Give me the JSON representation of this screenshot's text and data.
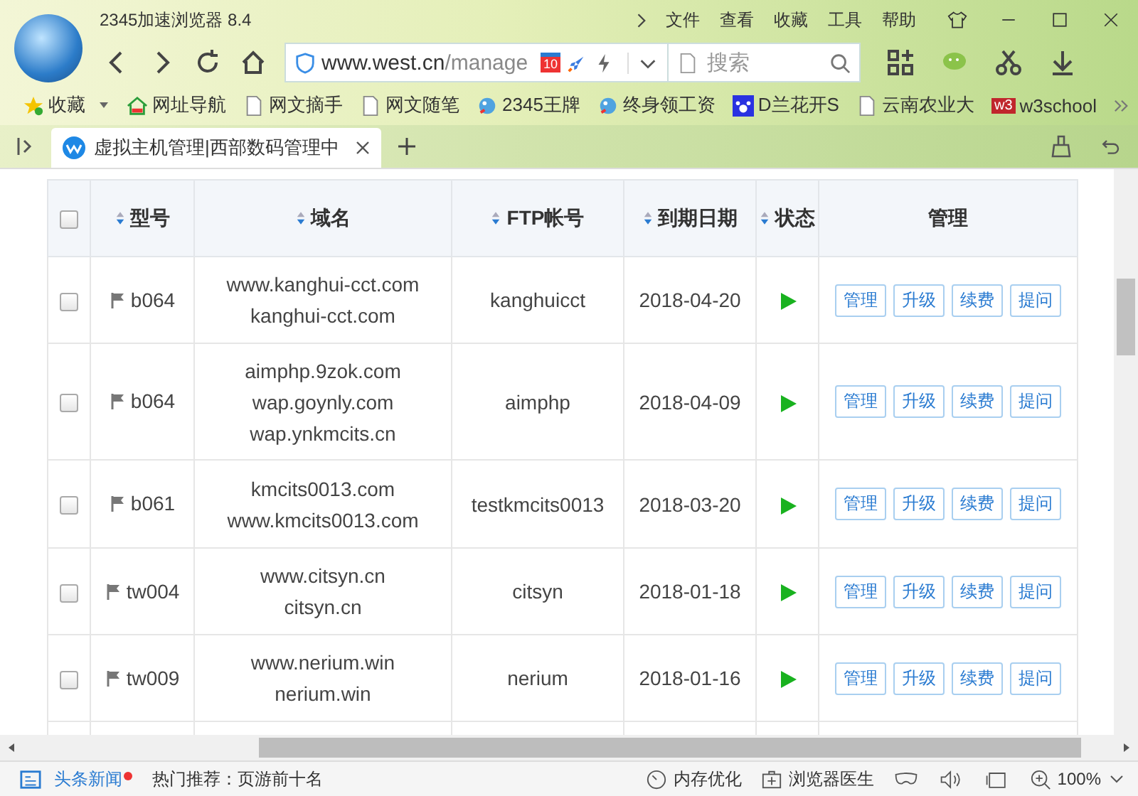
{
  "window": {
    "title": "2345加速浏览器 8.4"
  },
  "menu": [
    "文件",
    "查看",
    "收藏",
    "工具",
    "帮助"
  ],
  "address": {
    "url_host": "www.west.cn",
    "url_path": "/manage",
    "badge": "10"
  },
  "search": {
    "placeholder": "搜索"
  },
  "bookmarks": [
    {
      "label": "收藏",
      "kind": "star"
    },
    {
      "label": "网址导航",
      "kind": "home"
    },
    {
      "label": "网文摘手",
      "kind": "page"
    },
    {
      "label": "网文随笔",
      "kind": "page"
    },
    {
      "label": "2345王牌",
      "kind": "bird"
    },
    {
      "label": "终身领工资",
      "kind": "bird"
    },
    {
      "label": "D兰花开S",
      "kind": "paw"
    },
    {
      "label": "云南农业大",
      "kind": "page"
    },
    {
      "label": "w3school",
      "kind": "w3",
      "badge": "w3"
    }
  ],
  "tabs": [
    {
      "title": "虚拟主机管理|西部数码管理中",
      "selected": true
    }
  ],
  "table": {
    "all_checked": false,
    "columns": [
      {
        "label": "型号",
        "sortable": true
      },
      {
        "label": "域名",
        "sortable": true
      },
      {
        "label": "FTP帐号",
        "sortable": true
      },
      {
        "label": "到期日期",
        "sortable": true
      },
      {
        "label": "状态",
        "sortable": true
      },
      {
        "label": "管理",
        "sortable": false
      }
    ],
    "rows": [
      {
        "checked": false,
        "model": "b064",
        "domains": [
          "www.kanghui-cct.com",
          "kanghui-cct.com"
        ],
        "ftp": "kanghuicct",
        "expiry": "2018-04-20",
        "running": true,
        "actions": [
          "管理",
          "升级",
          "续费",
          "提问"
        ]
      },
      {
        "checked": false,
        "model": "b064",
        "domains": [
          "aimphp.9zok.com",
          "wap.goynly.com",
          "wap.ynkmcits.cn"
        ],
        "ftp": "aimphp",
        "expiry": "2018-04-09",
        "running": true,
        "actions": [
          "管理",
          "升级",
          "续费",
          "提问"
        ]
      },
      {
        "checked": false,
        "model": "b061",
        "domains": [
          "kmcits0013.com",
          "www.kmcits0013.com"
        ],
        "ftp": "testkmcits0013",
        "expiry": "2018-03-20",
        "running": true,
        "actions": [
          "管理",
          "升级",
          "续费",
          "提问"
        ]
      },
      {
        "checked": false,
        "model": "tw004",
        "domains": [
          "www.citsyn.cn",
          "citsyn.cn"
        ],
        "ftp": "citsyn",
        "expiry": "2018-01-18",
        "running": true,
        "actions": [
          "管理",
          "升级",
          "续费",
          "提问"
        ]
      },
      {
        "checked": false,
        "model": "tw009",
        "domains": [
          "www.nerium.win",
          "nerium.win"
        ],
        "ftp": "nerium",
        "expiry": "2018-01-16",
        "running": true,
        "actions": [
          "管理",
          "升级",
          "续费",
          "提问"
        ]
      }
    ]
  },
  "status_bar": {
    "news": "头条新闻",
    "news_unread": true,
    "hot": "热门推荐：页游前十名",
    "memory": "内存优化",
    "doctor": "浏览器医生",
    "zoom": "100%"
  }
}
